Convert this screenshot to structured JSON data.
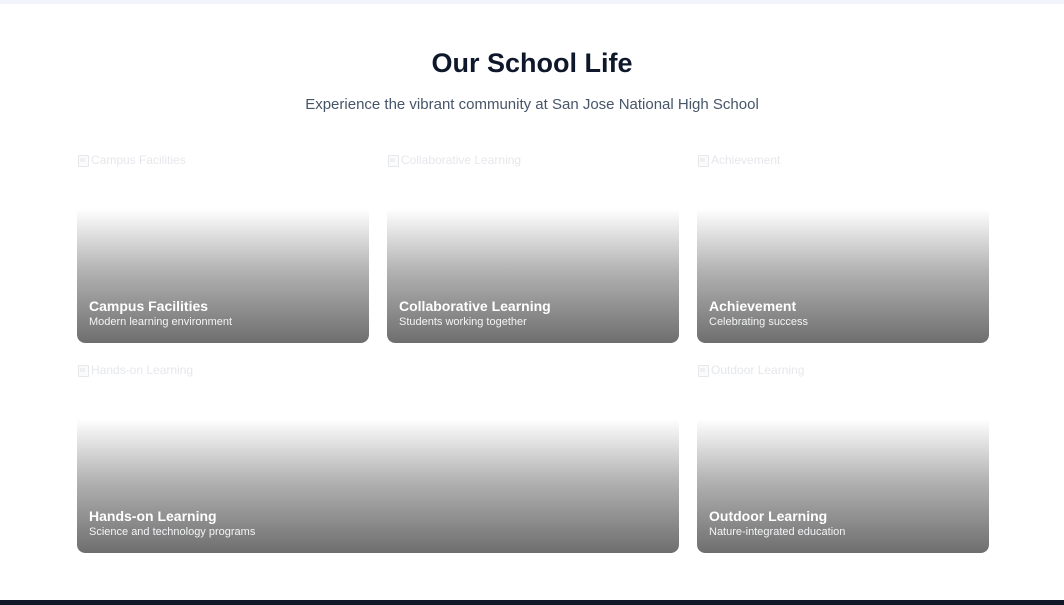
{
  "section": {
    "title": "Our School Life",
    "subtitle": "Experience the vibrant community at San Jose National High School"
  },
  "gallery": {
    "cards": [
      {
        "alt": "Campus Facilities",
        "title": "Campus Facilities",
        "description": "Modern learning environment"
      },
      {
        "alt": "Collaborative Learning",
        "title": "Collaborative Learning",
        "description": "Students working together"
      },
      {
        "alt": "Achievement",
        "title": "Achievement",
        "description": "Celebrating success"
      },
      {
        "alt": "Hands-on Learning",
        "title": "Hands-on Learning",
        "description": "Science and technology programs"
      },
      {
        "alt": "Outdoor Learning",
        "title": "Outdoor Learning",
        "description": "Nature-integrated education"
      }
    ]
  },
  "icons": {
    "image_placeholder": "broken-image-icon"
  },
  "colors": {
    "title": "#0f172a",
    "subtitle": "#475569",
    "footer": "#111827"
  }
}
